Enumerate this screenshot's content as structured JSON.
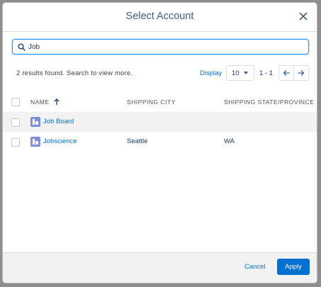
{
  "modal": {
    "title": "Select Account"
  },
  "search": {
    "value": "Job",
    "icon": "search-icon"
  },
  "toolbar": {
    "results_text": "2 results found. Search to view more.",
    "display_label": "Display",
    "page_size": "10",
    "range": "1 - 1"
  },
  "table": {
    "columns": [
      "NAME",
      "SHIPPING CITY",
      "SHIPPING STATE/PROVINCE"
    ],
    "sorted_column": "NAME",
    "sort_direction": "ascending",
    "rows": [
      {
        "name": "Job Board",
        "city": "",
        "state": ""
      },
      {
        "name": "Jobscience",
        "city": "Seattle",
        "state": "WA"
      }
    ]
  },
  "footer": {
    "cancel_label": "Cancel",
    "apply_label": "Apply"
  },
  "colors": {
    "accent": "#0070d2",
    "title": "#3e5f8a",
    "account_icon": "#7f8de1",
    "footer_bg": "#f3f2f2"
  }
}
